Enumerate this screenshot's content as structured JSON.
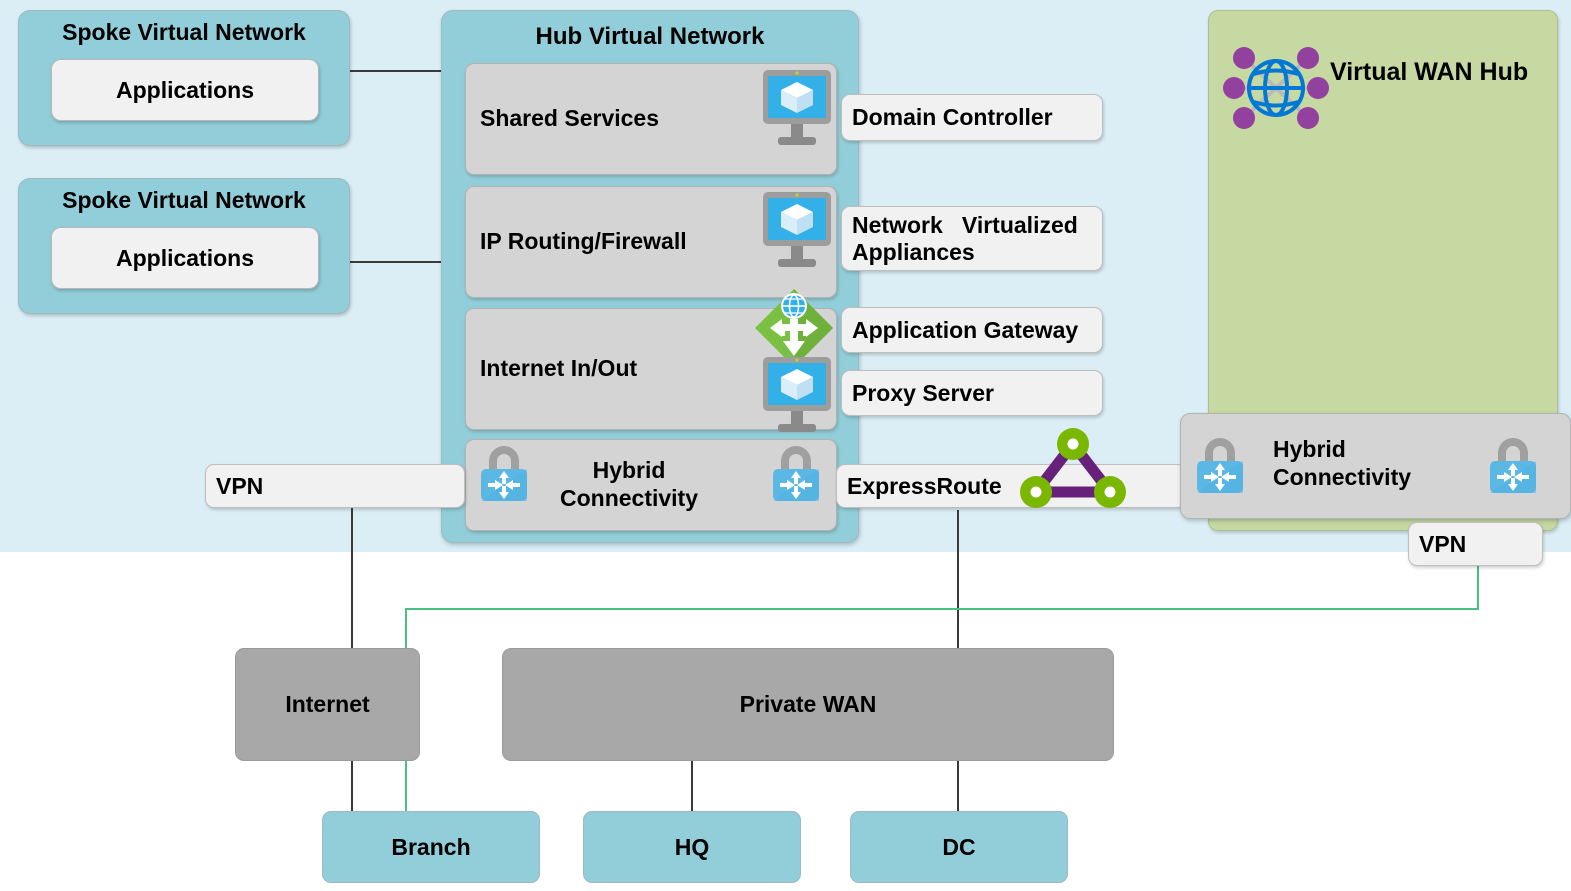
{
  "diagram": {
    "title": "Hub and spoke virtual network with Virtual WAN hub"
  },
  "colors": {
    "cloud_bg": "#dbeef6",
    "spoke_fill": "#92ced9",
    "hub_fill": "#92ced9",
    "service_row_fill": "#d4d4d4",
    "callout_fill": "#f1f1f1",
    "vwan_fill": "#c6d9a2",
    "gray_network": "#a8a8a8",
    "vpn_line": "#4cbf84",
    "connector_line": "#3a3a3a",
    "icon_blue": "#32b0e7",
    "icon_green": "#7ac143",
    "icon_purple": "#68217a",
    "icon_node_green": "#7ab800"
  },
  "spokes": [
    {
      "title": "Spoke Virtual Network",
      "app_label": "Applications"
    },
    {
      "title": "Spoke Virtual Network",
      "app_label": "Applications"
    }
  ],
  "hub": {
    "title": "Hub Virtual Network",
    "rows": [
      {
        "label": "Shared Services",
        "icon": "virtual-machine-icon"
      },
      {
        "label": "IP Routing/Firewall",
        "icon": "virtual-machine-icon"
      },
      {
        "label": "Internet In/Out",
        "icon": "application-gateway-icon"
      },
      {
        "label": "Hybrid Connectivity",
        "icon": "padlock-connectivity-icon"
      }
    ]
  },
  "callouts": {
    "domain_controller": "Domain Controller",
    "network_virtualized_appliances": "Network   Virtualized Appliances",
    "application_gateway": "Application Gateway",
    "proxy_server": "Proxy Server",
    "expressroute": "ExpressRoute",
    "vpn_left": "VPN",
    "vpn_right": "VPN"
  },
  "vwan": {
    "title": "Virtual WAN Hub",
    "icon": "globe-network-icon",
    "hybrid_connectivity": "Hybrid Connectivity"
  },
  "networks": [
    {
      "name": "Internet"
    },
    {
      "name": "Private WAN"
    }
  ],
  "sites": [
    {
      "name": "Branch"
    },
    {
      "name": "HQ"
    },
    {
      "name": "DC"
    }
  ]
}
